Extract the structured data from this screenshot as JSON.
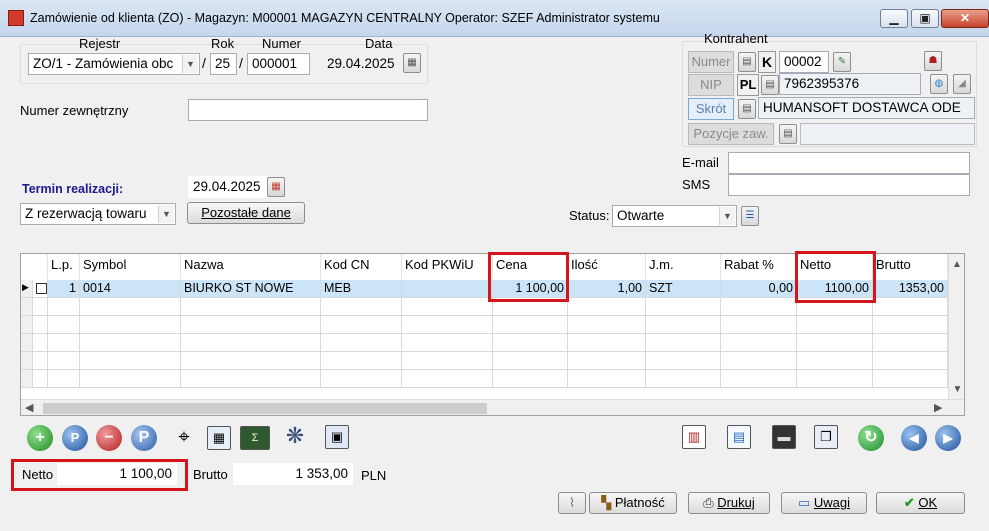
{
  "window": {
    "title": "Zamówienie od klienta (ZO) - Magazyn: M00001 MAGAZYN CENTRALNY  Operator: SZEF Administrator systemu",
    "minimize": "▁",
    "maximize": "▣",
    "close": "✕"
  },
  "header": {
    "rejestr_label": "Rejestr",
    "rok_label": "Rok",
    "numer_label": "Numer",
    "data_label": "Data",
    "rejestr_value": "ZO/1  - Zamówienia obc",
    "slash1": "/",
    "slash2": "/",
    "rok_value": "25",
    "numer_value": "000001",
    "data_value": "29.04.2025",
    "numer_zewnetrzny_label": "Numer zewnętrzny",
    "numer_zewnetrzny_value": "",
    "termin_label": "Termin realizacji:",
    "termin_value": "29.04.2025",
    "rezerwacja_value": "Z rezerwacją towaru",
    "pozostale_button": "Pozostałe dane",
    "status_label": "Status:",
    "status_value": "Otwarte"
  },
  "kontrahent": {
    "group_label": "Kontrahent",
    "numer_button": "Numer",
    "numer_prefix": "K",
    "numer_value": "00002",
    "nip_button": "NIP",
    "nip_prefix": "PL",
    "nip_value": "7962395376",
    "skrot_button": "Skrót",
    "skrot_value": "HUMANSOFT DOSTAWCA ODE",
    "pozycje_button": "Pozycje zaw.",
    "pozycje_value": "",
    "email_label": "E-mail",
    "email_value": "",
    "sms_label": "SMS",
    "sms_value": ""
  },
  "grid": {
    "columns": [
      "L.p.",
      "Symbol",
      "Nazwa",
      "Kod CN",
      "Kod PKWiU",
      "Cena",
      "Ilość",
      "J.m.",
      "Rabat %",
      "Netto",
      "Brutto"
    ],
    "rows": [
      {
        "lp": "1",
        "symbol": "0014",
        "nazwa": "BIURKO ST NOWE",
        "kod_cn": "MEB",
        "kod_pkwiu": "",
        "cena": "1 100,00",
        "ilosc": "1,00",
        "jm": "SZT",
        "rabat": "0,00",
        "netto": "1100,00",
        "brutto": "1353,00"
      }
    ],
    "empty_rows": 5
  },
  "toolbar_icons": [
    "add-icon",
    "search-icon",
    "remove-icon",
    "p-icon",
    "binoculars-icon",
    "calculator-icon",
    "sum-icon",
    "settings-icon",
    "window-icon"
  ],
  "right_icons": [
    "chart-icon",
    "document-icon",
    "save-icon",
    "windows-icon",
    "refresh-icon",
    "prev-icon",
    "next-icon"
  ],
  "totals": {
    "netto_label": "Netto",
    "netto_value": "1 100,00",
    "brutto_label": "Brutto",
    "brutto_value": "1 353,00",
    "currency": "PLN"
  },
  "footer": {
    "platnosc_button": "Płatność",
    "drukuj_button": "Drukuj",
    "uwagi_button": "Uwagi",
    "ok_button": "OK"
  },
  "colors": {
    "highlight": "#d4151b",
    "selected_row": "#cce4f7",
    "termin_label": "#1a1a8c"
  }
}
